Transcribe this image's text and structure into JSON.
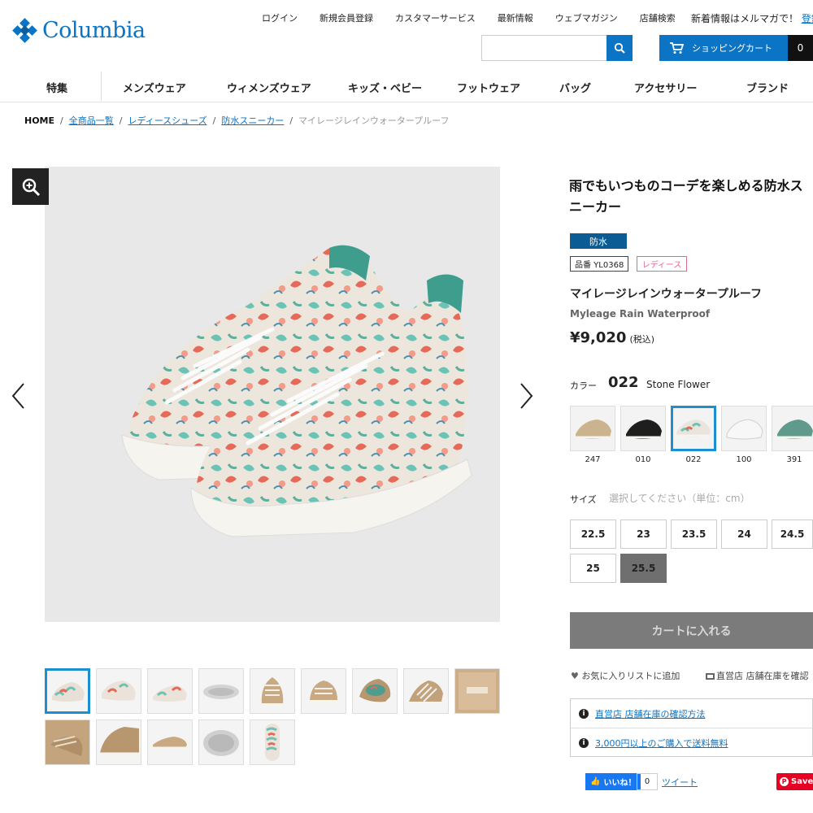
{
  "brand": {
    "logo_text": "Columbia",
    "accent": "#0b74c4"
  },
  "top_nav": [
    "ログイン",
    "新規会員登録",
    "カスタマーサービス",
    "最新情報",
    "ウェブマガジン",
    "店舗検索"
  ],
  "mail_note": {
    "text": "新着情報はメルマガで！",
    "link": "登録⇒"
  },
  "search": {
    "placeholder": ""
  },
  "cart": {
    "label": "ショッピングカート",
    "count": "0"
  },
  "main_nav": [
    "特集",
    "メンズウェア",
    "ウィメンズウェア",
    "キッズ・ベビー",
    "フットウェア",
    "バッグ",
    "アクセサリー",
    "ブランド"
  ],
  "breadcrumb": {
    "home": "HOME",
    "links": [
      "全商品一覧",
      "レディースシューズ",
      "防水スニーカー"
    ],
    "current": "マイレージレインウォータープルーフ"
  },
  "product": {
    "tagline": "雨でもいつものコーデを楽しめる防水スニーカー",
    "badge": "防水",
    "item_no": "品番 YL0368",
    "category": "レディース",
    "name_jp": "マイレージレインウォータープルーフ",
    "name_en": "Myleage Rain Waterproof",
    "price": "¥9,020",
    "tax": "(税込)"
  },
  "color": {
    "label": "カラー",
    "code": "022",
    "name": "Stone Flower",
    "swatches": [
      {
        "code": "247",
        "tone": "#cbb38e"
      },
      {
        "code": "010",
        "tone": "#1e1e1e"
      },
      {
        "code": "022",
        "tone": "#e9e4dc"
      },
      {
        "code": "100",
        "tone": "#f7f7f7"
      },
      {
        "code": "391",
        "tone": "#5f9a8c"
      }
    ]
  },
  "size": {
    "label": "サイズ",
    "hint": "選択してください（単位：cm）",
    "options": [
      "22.5",
      "23",
      "23.5",
      "24",
      "24.5",
      "25",
      "25.5"
    ],
    "selected": "25.5"
  },
  "add_to_cart": "カートに入れる",
  "favorite": "お気に入りリストに追加",
  "store_stock": "直営店 店舗在庫を確認",
  "info": [
    "直営店 店舗在庫の確認方法",
    "3,000円以上のご購入で送料無料"
  ],
  "social": {
    "like": "いいね！",
    "like_count": "0",
    "tweet": "ツイート",
    "save": "Save"
  }
}
